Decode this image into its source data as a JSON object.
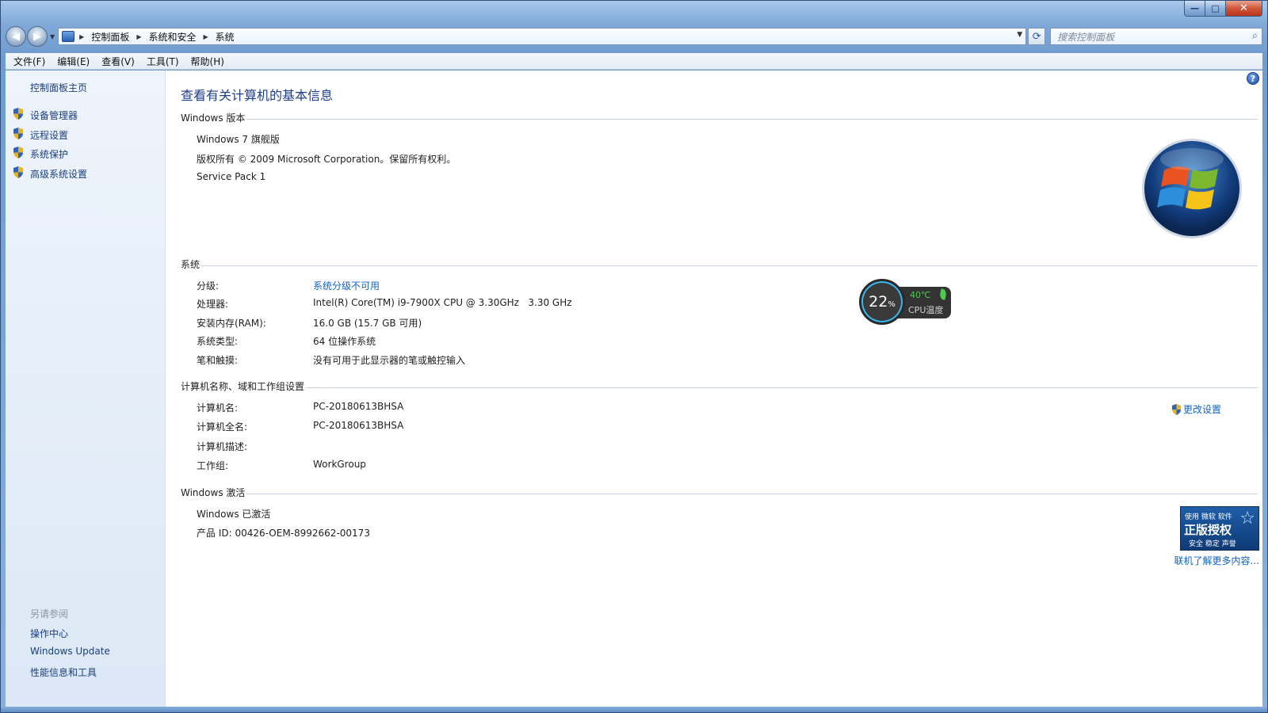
{
  "window": {
    "caption": {
      "minimize": "—",
      "maximize": "□",
      "close": "✕"
    }
  },
  "nav": {
    "back_glyph": "◀",
    "forward_glyph": "▶",
    "breadcrumb": [
      "控制面板",
      "系统和安全",
      "系统"
    ],
    "search_placeholder": "搜索控制面板",
    "refresh_glyph": "⟳",
    "search_glyph": "⌕"
  },
  "menu": [
    "文件(F)",
    "编辑(E)",
    "查看(V)",
    "工具(T)",
    "帮助(H)"
  ],
  "sidebar": {
    "home": "控制面板主页",
    "tasks": [
      "设备管理器",
      "远程设置",
      "系统保护",
      "高级系统设置"
    ],
    "see_also_title": "另请参阅",
    "see_also": [
      "操作中心",
      "Windows Update",
      "性能信息和工具"
    ]
  },
  "main": {
    "help": "?",
    "title": "查看有关计算机的基本信息",
    "edition": {
      "heading": "Windows 版本",
      "name": "Windows 7 旗舰版",
      "copyright": "版权所有 © 2009 Microsoft Corporation。保留所有权利。",
      "service_pack": "Service Pack 1"
    },
    "system": {
      "heading": "系统",
      "rows": [
        {
          "label": "分级:",
          "value": "系统分级不可用"
        },
        {
          "label": "处理器:",
          "value": "Intel(R) Core(TM) i9-7900X CPU @ 3.30GHz   3.30 GHz"
        },
        {
          "label": "安装内存(RAM):",
          "value": "16.0 GB (15.7 GB 可用)"
        },
        {
          "label": "系统类型:",
          "value": "64 位操作系统"
        },
        {
          "label": "笔和触摸:",
          "value": "没有可用于此显示器的笔或触控输入"
        }
      ]
    },
    "computer": {
      "heading": "计算机名称、域和工作组设置",
      "rows": [
        {
          "label": "计算机名:",
          "value": "PC-20180613BHSA"
        },
        {
          "label": "计算机全名:",
          "value": "PC-20180613BHSA"
        },
        {
          "label": "计算机描述:",
          "value": ""
        },
        {
          "label": "工作组:",
          "value": "WorkGroup"
        }
      ],
      "change_settings": "更改设置"
    },
    "activation": {
      "heading": "Windows 激活",
      "status": "Windows 已激活",
      "product_id": "产品 ID: 00426-OEM-8992662-00173",
      "genuine_top": "使用 微软 软件",
      "genuine_main": "正版授权",
      "genuine_bottom": "安全 稳定 声誉",
      "learn_more": "联机了解更多内容..."
    }
  },
  "cpu_widget": {
    "usage": "22",
    "unit": "%",
    "temperature": "40℃",
    "label": "CPU温度",
    "ring_color": "#39b9f0",
    "temp_color": "#4fc84f"
  },
  "colors": {
    "link": "#0f64c8",
    "title": "#1e3e8c",
    "sidebar_link": "#1a3e7e"
  }
}
